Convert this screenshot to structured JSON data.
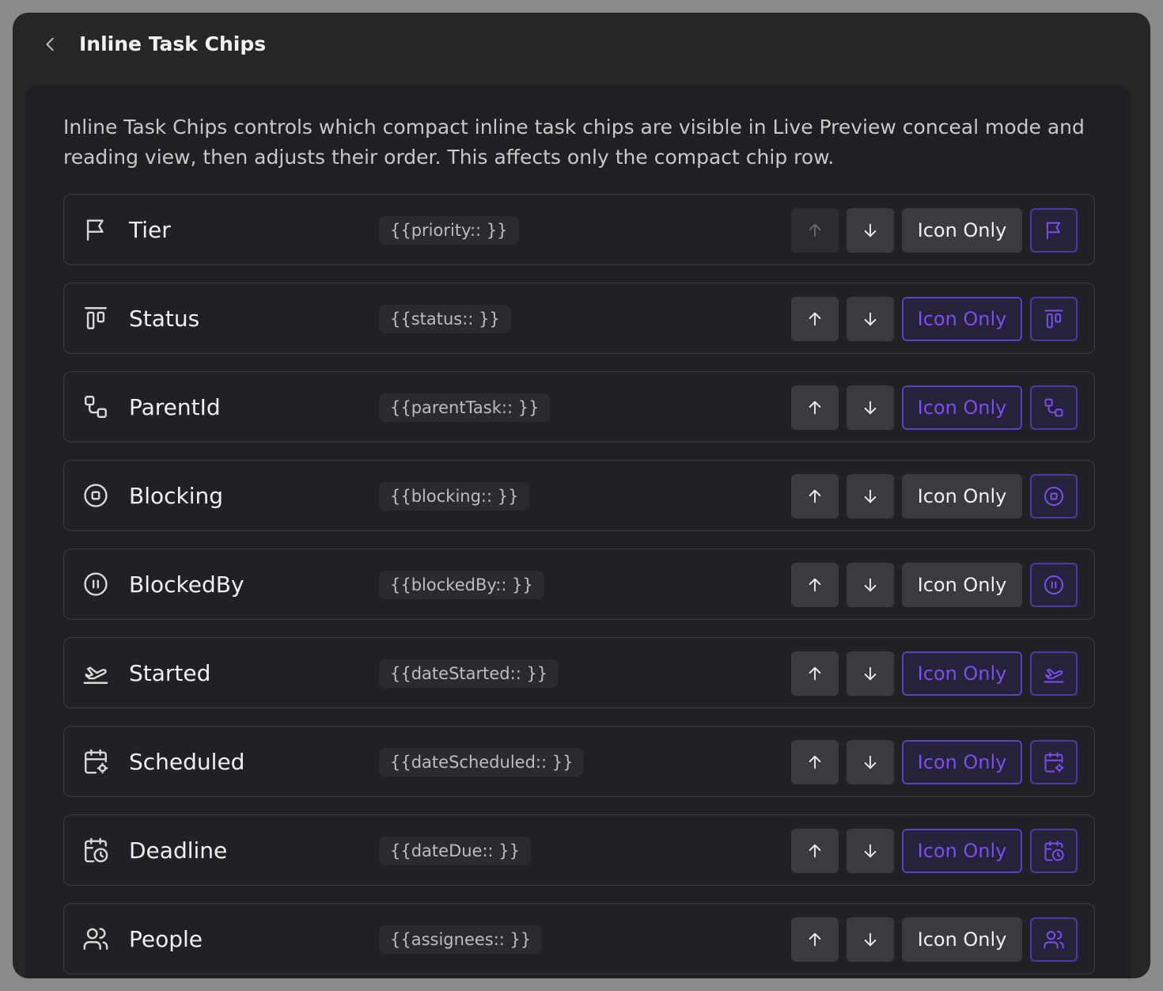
{
  "header": {
    "title": "Inline Task Chips",
    "back_icon": "chevron-left-icon"
  },
  "description": "Inline Task Chips controls which compact inline task chips are visible in Live Preview conceal mode and reading view, then adjusts their order. This affects only the compact chip row.",
  "colors": {
    "accent": "#7a4ff0",
    "accent_border": "#5b3fc7",
    "row_bg": "#202125",
    "button_bg": "#3a3b3f"
  },
  "mode_label": "Icon Only",
  "rows": [
    {
      "label": "Tier",
      "token": "{{priority:: }}",
      "icon": "flag-icon",
      "mode_active": false,
      "up_disabled": true
    },
    {
      "label": "Status",
      "token": "{{status:: }}",
      "icon": "kanban-icon",
      "mode_active": true,
      "up_disabled": false
    },
    {
      "label": "ParentId",
      "token": "{{parentTask:: }}",
      "icon": "hierarchy-icon",
      "mode_active": true,
      "up_disabled": false
    },
    {
      "label": "Blocking",
      "token": "{{blocking:: }}",
      "icon": "stop-circle-icon",
      "mode_active": false,
      "up_disabled": false
    },
    {
      "label": "BlockedBy",
      "token": "{{blockedBy:: }}",
      "icon": "pause-circle-icon",
      "mode_active": false,
      "up_disabled": false
    },
    {
      "label": "Started",
      "token": "{{dateStarted:: }}",
      "icon": "plane-takeoff-icon",
      "mode_active": true,
      "up_disabled": false
    },
    {
      "label": "Scheduled",
      "token": "{{dateScheduled:: }}",
      "icon": "calendar-cog-icon",
      "mode_active": true,
      "up_disabled": false
    },
    {
      "label": "Deadline",
      "token": "{{dateDue:: }}",
      "icon": "calendar-clock-icon",
      "mode_active": true,
      "up_disabled": false
    },
    {
      "label": "People",
      "token": "{{assignees:: }}",
      "icon": "users-icon",
      "mode_active": false,
      "up_disabled": false
    }
  ]
}
